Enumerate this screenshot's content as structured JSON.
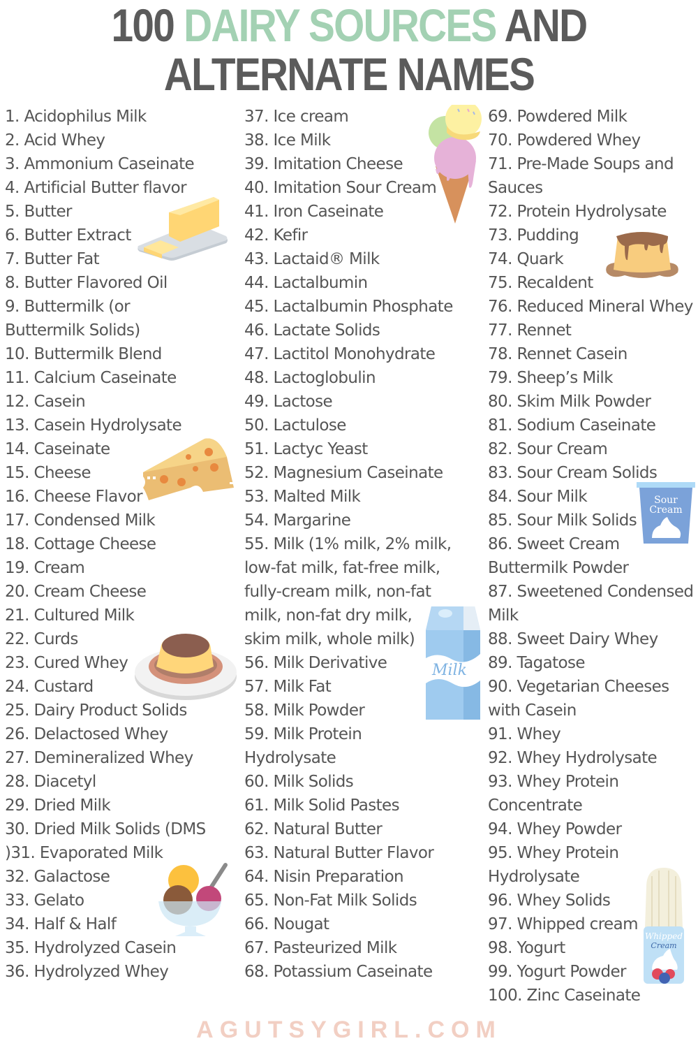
{
  "header": {
    "title_part1": "100 ",
    "title_accent": "DAIRY SOURCES",
    "title_part2": " AND",
    "title_line2": "ALTERNATE NAMES",
    "accent_color": "#a3d1b3",
    "text_color": "#5b5b5b"
  },
  "columns": [
    {
      "lines": [
        "1. Acidophilus Milk",
        "2. Acid Whey",
        "3. Ammonium Caseinate",
        "4. Artificial Butter flavor",
        "5. Butter",
        "6. Butter Extract",
        "7. Butter Fat",
        "8. Butter Flavored Oil",
        "9. Buttermilk (or",
        "Buttermilk Solids)",
        "10. Buttermilk Blend",
        "11. Calcium Caseinate",
        "12. Casein",
        "13. Casein Hydrolysate",
        "14. Caseinate",
        "15. Cheese",
        "16. Cheese Flavor",
        "17. Condensed Milk",
        "18. Cottage Cheese",
        "19. Cream",
        "20. Cream Cheese",
        "21. Cultured Milk",
        "22. Curds",
        "23. Cured Whey",
        "24. Custard",
        "25. Dairy Product Solids",
        "26. Delactosed Whey",
        "27. Demineralized Whey",
        "28. Diacetyl",
        "29. Dried Milk",
        "30. Dried Milk Solids (DMS",
        ")31. Evaporated Milk",
        "32. Galactose",
        "33. Gelato",
        "34. Half & Half",
        "35. Hydrolyzed Casein",
        "36. Hydrolyzed Whey"
      ]
    },
    {
      "lines": [
        "37. Ice cream",
        "38. Ice Milk",
        "39. Imitation Cheese",
        "40. Imitation Sour Cream",
        "41. Iron Caseinate",
        "42. Kefir",
        "43. Lactaid® Milk",
        "44. Lactalbumin",
        "45. Lactalbumin Phosphate",
        "46. Lactate Solids",
        "47. Lactitol Monohydrate",
        "48. Lactoglobulin",
        "49. Lactose",
        "50. Lactulose",
        "51. Lactyc Yeast",
        "52. Magnesium Caseinate",
        "53. Malted Milk",
        "54. Margarine",
        "55. Milk (1% milk, 2% milk,",
        "low-fat milk, fat-free milk,",
        "fully-cream milk,  non-fat",
        "milk, non-fat dry milk,",
        "skim milk, whole milk)",
        "56. Milk Derivative",
        "57. Milk Fat",
        "58. Milk Powder",
        "59. Milk Protein",
        "Hydrolysate",
        "60. Milk Solids",
        "61. Milk Solid Pastes",
        "62. Natural Butter",
        "63. Natural Butter Flavor",
        "64. Nisin Preparation",
        "65. Non-Fat Milk Solids",
        "66. Nougat",
        "67. Pasteurized Milk",
        "68. Potassium Caseinate"
      ]
    },
    {
      "lines": [
        "69. Powdered Milk",
        "70. Powdered Whey",
        "71. Pre-Made Soups and",
        "Sauces",
        "72. Protein Hydrolysate",
        "73. Pudding",
        "74. Quark",
        "75. Recaldent",
        "76. Reduced Mineral Whey",
        "77. Rennet",
        "78. Rennet Casein",
        "79. Sheep’s Milk",
        "80. Skim Milk Powder",
        "81. Sodium Caseinate",
        "82. Sour Cream",
        "83. Sour Cream Solids",
        "84. Sour Milk",
        "85. Sour Milk Solids",
        "86. Sweet Cream",
        "Buttermilk Powder",
        "87. Sweetened Condensed",
        "Milk",
        "88. Sweet Dairy Whey",
        "89. Tagatose",
        "90. Vegetarian Cheeses",
        "with Casein",
        "91. Whey",
        "92. Whey Hydrolysate",
        "93. Whey Protein",
        "Concentrate",
        "94. Whey Powder",
        "95. Whey Protein",
        "Hydrolysate",
        "96. Whey Solids",
        "97. Whipped cream",
        "98. Yogurt",
        "99. Yogurt Powder",
        "100. Zinc Caseinate"
      ]
    }
  ],
  "illustrations": {
    "butter": "butter-icon",
    "cheese": "cheese-icon",
    "flan": "flan-icon",
    "sundae": "ice-cream-sundae-icon",
    "cone": "ice-cream-cone-icon",
    "milk_carton": "milk-carton-icon",
    "milk_carton_label": "Milk",
    "pudding": "pudding-icon",
    "sour_cream": "sour-cream-tub-icon",
    "sour_cream_label_1": "Sour",
    "sour_cream_label_2": "Cream",
    "whipped_cream": "whipped-cream-can-icon",
    "whipped_cream_label_1": "Whipped",
    "whipped_cream_label_2": "Cream"
  },
  "footer": {
    "site": "AGUTSYGIRL.COM",
    "color": "#f2cfc3"
  }
}
